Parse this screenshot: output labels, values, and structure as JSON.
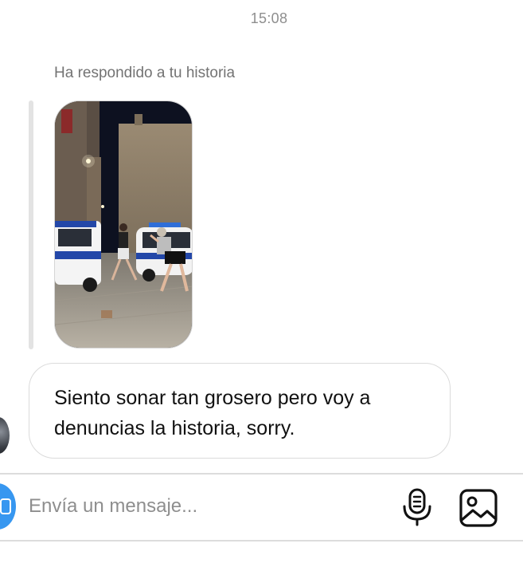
{
  "thread": {
    "timestamp": "15:08",
    "reply_context": "Ha respondido a tu historia",
    "story": {
      "kind": "photo",
      "description_icon": "story-photo"
    },
    "message": {
      "line1": "Siento sonar tan grosero pero voy a",
      "line2": "denuncias la historia, sorry."
    }
  },
  "composer": {
    "placeholder": "Envía un mensaje...",
    "value": "",
    "icons": {
      "camera": "camera-icon",
      "mic": "microphone-icon",
      "gallery": "image-gallery-icon"
    }
  },
  "colors": {
    "accent": "#3797f0",
    "meta_text": "#8e8e8e",
    "bubble_border": "#dbdbdb"
  }
}
